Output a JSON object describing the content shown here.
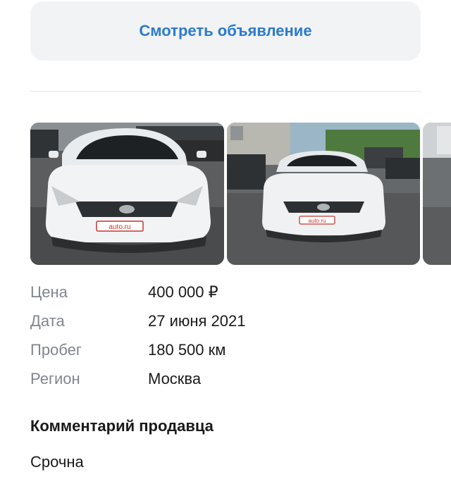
{
  "view_ad_button": {
    "label": "Смотреть объявление"
  },
  "gallery": {
    "photos": [
      {
        "plate": "auto.ru",
        "alt": "car-photo-front"
      },
      {
        "plate": "auto.ru",
        "alt": "car-photo-front-wide"
      },
      {
        "alt": "car-photo-partial"
      }
    ]
  },
  "details": [
    {
      "label": "Цена",
      "value": "400 000 ₽"
    },
    {
      "label": "Дата",
      "value": "27 июня 2021"
    },
    {
      "label": "Пробег",
      "value": "180 500 км"
    },
    {
      "label": "Регион",
      "value": "Москва"
    }
  ],
  "comment": {
    "title": "Комментарий продавца",
    "text": "Срочна"
  },
  "colors": {
    "accent": "#2a7bd0",
    "label_gray": "#80868e",
    "button_bg": "#f2f3f5"
  }
}
